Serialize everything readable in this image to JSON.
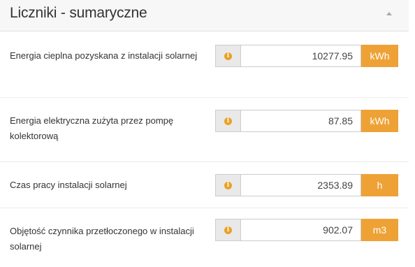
{
  "panel": {
    "title": "Liczniki - sumaryczne",
    "collapse_icon": "chevron-up-icon"
  },
  "colors": {
    "unit_accent": "#eea236",
    "info_icon": "#e8a324",
    "header_bg": "#f7f7f7"
  },
  "counters": [
    {
      "label": "Energia cieplna pozyskana z instalacji solarnej",
      "value": "10277.95",
      "unit": "kWh",
      "icon": "info-icon"
    },
    {
      "label": "Energia elektryczna zużyta przez pompę kolektorową",
      "value": "87.85",
      "unit": "kWh",
      "icon": "info-icon"
    },
    {
      "label": "Czas pracy instalacji solarnej",
      "value": "2353.89",
      "unit": "h",
      "icon": "info-icon"
    },
    {
      "label": "Objętość czynnika przetłoczonego w instalacji solarnej",
      "value": "902.07",
      "unit": "m3",
      "icon": "info-icon"
    }
  ]
}
